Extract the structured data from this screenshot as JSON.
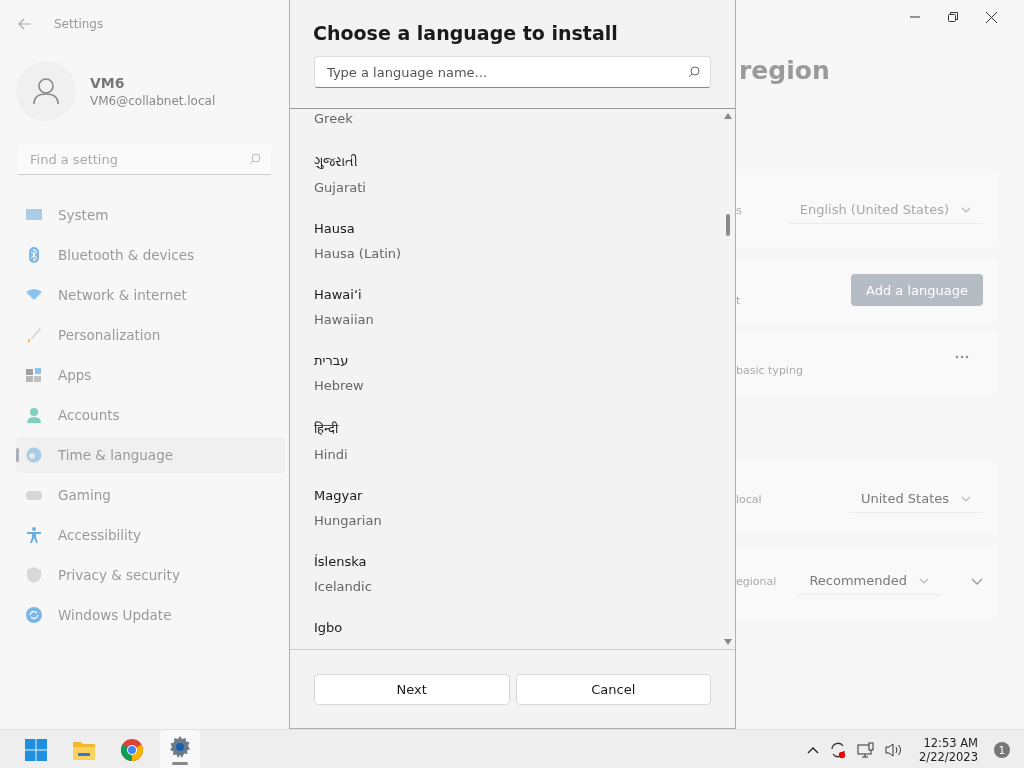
{
  "window": {
    "title": "Settings"
  },
  "account": {
    "name": "VM6",
    "email": "VM6@collabnet.local"
  },
  "search": {
    "placeholder": "Find a setting"
  },
  "nav": [
    {
      "label": "System",
      "kind": "system",
      "selected": false
    },
    {
      "label": "Bluetooth & devices",
      "kind": "bluetooth",
      "selected": false
    },
    {
      "label": "Network & internet",
      "kind": "network",
      "selected": false
    },
    {
      "label": "Personalization",
      "kind": "brush",
      "selected": false
    },
    {
      "label": "Apps",
      "kind": "apps",
      "selected": false
    },
    {
      "label": "Accounts",
      "kind": "person",
      "selected": false
    },
    {
      "label": "Time & language",
      "kind": "globe",
      "selected": true
    },
    {
      "label": "Gaming",
      "kind": "gamepad",
      "selected": false
    },
    {
      "label": "Accessibility",
      "kind": "accessibility",
      "selected": false
    },
    {
      "label": "Privacy & security",
      "kind": "shield",
      "selected": false
    },
    {
      "label": "Windows Update",
      "kind": "update",
      "selected": false
    }
  ],
  "page": {
    "heading": "region",
    "cards": [
      {
        "kind": "dropdown",
        "label": "s",
        "value": "English (United States)",
        "disabled": true
      },
      {
        "kind": "button",
        "label": "t",
        "button": "Add a language"
      },
      {
        "kind": "more",
        "label": "basic typing"
      },
      {
        "kind": "dropdown",
        "label": "local",
        "value": "United States",
        "disabled": false
      },
      {
        "kind": "dropdown",
        "label": "egional",
        "value": "Recommended",
        "disabled": false,
        "expandable": true
      }
    ]
  },
  "dialog": {
    "title": "Choose a language to install",
    "search": {
      "placeholder": "Type a language name..."
    },
    "languages": [
      {
        "english": "Greek"
      },
      {
        "native": "ગુજરાતી",
        "english": "Gujarati"
      },
      {
        "native": "Hausa",
        "english": "Hausa (Latin)"
      },
      {
        "native": "Hawaiʻi",
        "english": "Hawaiian"
      },
      {
        "native": "עברית",
        "english": "Hebrew"
      },
      {
        "native": "हिन्दी",
        "english": "Hindi"
      },
      {
        "native": "Magyar",
        "english": "Hungarian"
      },
      {
        "native": "Íslenska",
        "english": "Icelandic"
      },
      {
        "native": "Igbo"
      }
    ],
    "buttons": [
      "Next",
      "Cancel"
    ]
  },
  "taskbar": {
    "apps": [
      {
        "kind": "start",
        "selected": false
      },
      {
        "kind": "folder",
        "selected": false
      },
      {
        "kind": "browser",
        "selected": false
      },
      {
        "kind": "settings",
        "selected": true
      }
    ],
    "time": "12:53 AM",
    "date": "2/22/2023",
    "notifications": "1"
  }
}
